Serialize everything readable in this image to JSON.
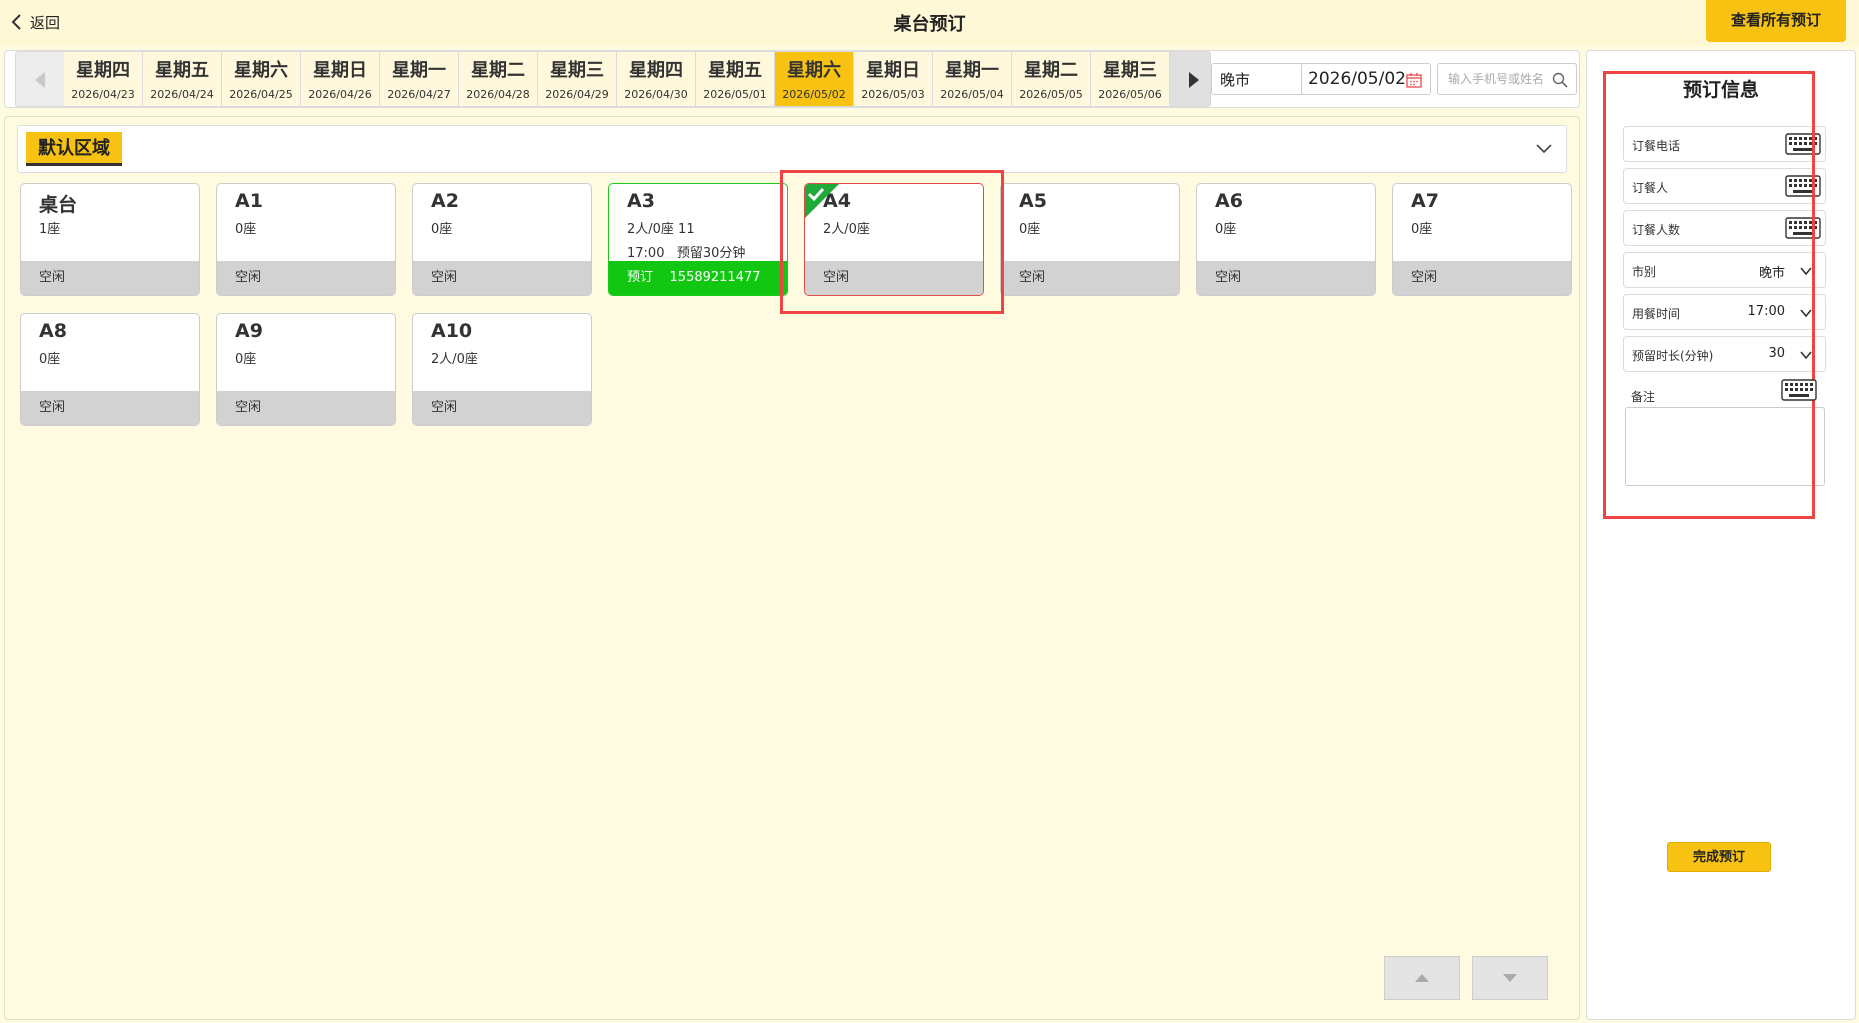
{
  "header": {
    "back_label": "返回",
    "title": "桌台预订",
    "view_all_label": "查看所有预订"
  },
  "date_bar": {
    "days": [
      {
        "weekday": "星期四",
        "date": "2026/04/23"
      },
      {
        "weekday": "星期五",
        "date": "2026/04/24"
      },
      {
        "weekday": "星期六",
        "date": "2026/04/25"
      },
      {
        "weekday": "星期日",
        "date": "2026/04/26"
      },
      {
        "weekday": "星期一",
        "date": "2026/04/27"
      },
      {
        "weekday": "星期二",
        "date": "2026/04/28"
      },
      {
        "weekday": "星期三",
        "date": "2026/04/29"
      },
      {
        "weekday": "星期四",
        "date": "2026/04/30"
      },
      {
        "weekday": "星期五",
        "date": "2026/05/01"
      },
      {
        "weekday": "星期六",
        "date": "2026/05/02"
      },
      {
        "weekday": "星期日",
        "date": "2026/05/03"
      },
      {
        "weekday": "星期一",
        "date": "2026/05/04"
      },
      {
        "weekday": "星期二",
        "date": "2026/05/05"
      },
      {
        "weekday": "星期三",
        "date": "2026/05/06"
      }
    ],
    "active_index": 9,
    "market": "晚市",
    "date_value": "2026/05/02",
    "search_placeholder": "输入手机号或姓名"
  },
  "zone": {
    "name": "默认区域"
  },
  "tables": [
    {
      "name": "桌台",
      "seats": "1座",
      "extra": "",
      "status": "空闲",
      "state": "free"
    },
    {
      "name": "A1",
      "seats": "0座",
      "extra": "",
      "status": "空闲",
      "state": "free"
    },
    {
      "name": "A2",
      "seats": "0座",
      "extra": "",
      "status": "空闲",
      "state": "free"
    },
    {
      "name": "A3",
      "seats": "2人/0座   11",
      "extra": "17:00   预留30分钟",
      "status": "预订    15589211477",
      "state": "reserved"
    },
    {
      "name": "A4",
      "seats": "2人/0座",
      "extra": "",
      "status": "空闲",
      "state": "selected"
    },
    {
      "name": "A5",
      "seats": "0座",
      "extra": "",
      "status": "空闲",
      "state": "free"
    },
    {
      "name": "A6",
      "seats": "0座",
      "extra": "",
      "status": "空闲",
      "state": "free"
    },
    {
      "name": "A7",
      "seats": "0座",
      "extra": "",
      "status": "空闲",
      "state": "free"
    },
    {
      "name": "A8",
      "seats": "0座",
      "extra": "",
      "status": "空闲",
      "state": "free"
    },
    {
      "name": "A9",
      "seats": "0座",
      "extra": "",
      "status": "空闲",
      "state": "free"
    },
    {
      "name": "A10",
      "seats": "2人/0座",
      "extra": "",
      "status": "空闲",
      "state": "free"
    }
  ],
  "form": {
    "title": "预订信息",
    "phone_label": "订餐电话",
    "name_label": "订餐人",
    "count_label": "订餐人数",
    "market_label": "市别",
    "market_value": "晚市",
    "time_label": "用餐时间",
    "time_value": "17:00",
    "hold_label": "预留时长(分钟)",
    "hold_value": "30",
    "notes_label": "备注",
    "complete_label": "完成预订"
  },
  "colors": {
    "accent": "#f7c211",
    "reserved": "#11c711",
    "highlight": "#ef4444",
    "background": "#fffbe0"
  }
}
